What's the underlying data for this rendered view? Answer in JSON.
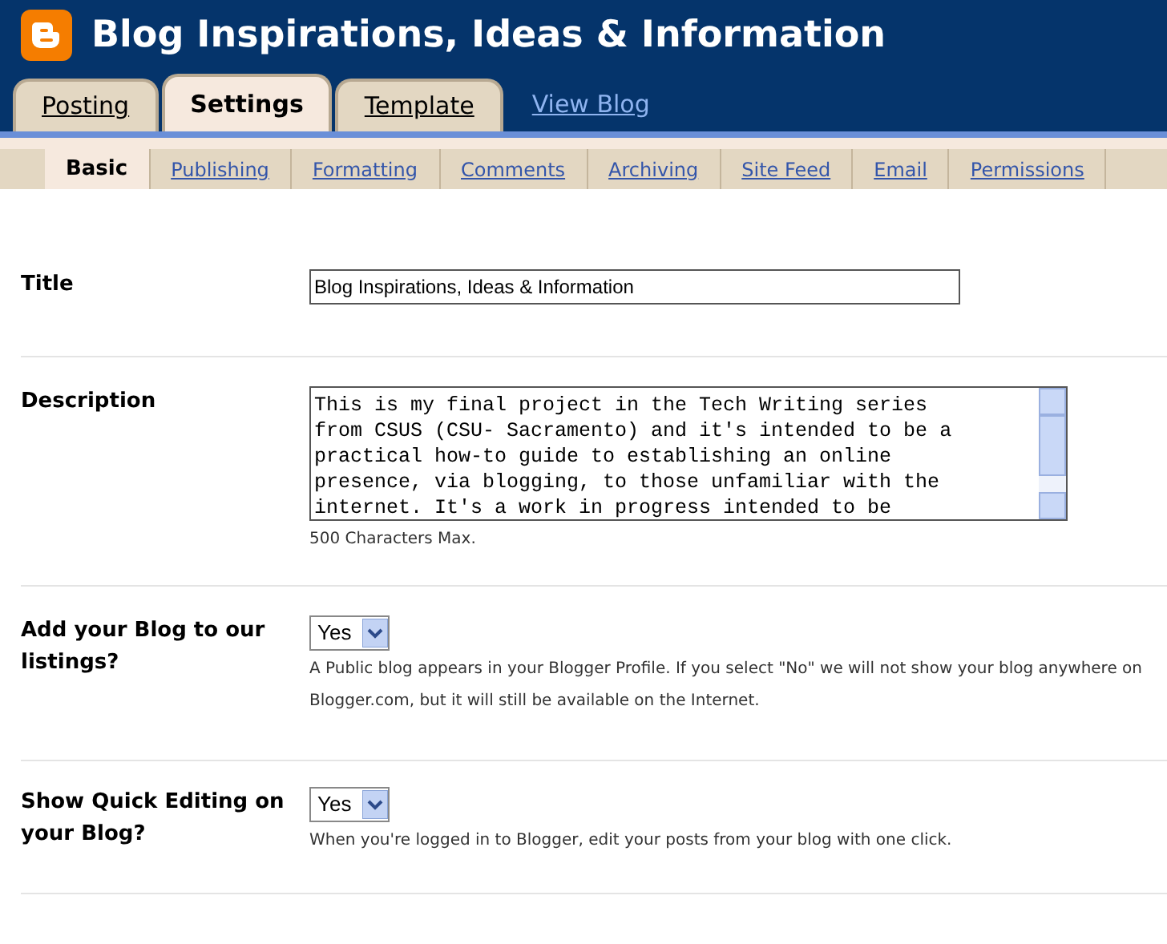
{
  "header": {
    "title": "Blog Inspirations, Ideas & Information"
  },
  "tabs": [
    {
      "label": "Posting",
      "selected": false
    },
    {
      "label": "Settings",
      "selected": true
    },
    {
      "label": "Template",
      "selected": false
    }
  ],
  "view_blog_link": "View Blog",
  "subtabs": [
    {
      "label": "Basic",
      "selected": true
    },
    {
      "label": "Publishing",
      "selected": false
    },
    {
      "label": "Formatting",
      "selected": false
    },
    {
      "label": "Comments",
      "selected": false
    },
    {
      "label": "Archiving",
      "selected": false
    },
    {
      "label": "Site Feed",
      "selected": false
    },
    {
      "label": "Email",
      "selected": false
    },
    {
      "label": "Permissions",
      "selected": false
    }
  ],
  "settings": [
    {
      "kind": "text",
      "label": "Title",
      "value": "Blog Inspirations, Ideas & Information"
    },
    {
      "kind": "textarea",
      "label": "Description",
      "value_lines": [
        "This is my final project in the Tech Writing series",
        "from CSUS (CSU- Sacramento) and it's intended to be a",
        "practical how-to guide to establishing an online",
        "presence, via blogging, to those unfamiliar with the",
        "internet. It's a work in progress intended to be"
      ],
      "hint": "500 Characters Max."
    },
    {
      "kind": "select",
      "label": "Add your Blog to our listings?",
      "value": "Yes",
      "hint": "A Public blog appears in your Blogger Profile. If you select \"No\" we will not show your blog anywhere on Blogger.com, but it will still be available on the Internet."
    },
    {
      "kind": "select",
      "label": "Show Quick Editing on your Blog?",
      "value": "Yes",
      "hint": "When you're logged in to Blogger, edit your posts from your blog with one click."
    }
  ]
}
